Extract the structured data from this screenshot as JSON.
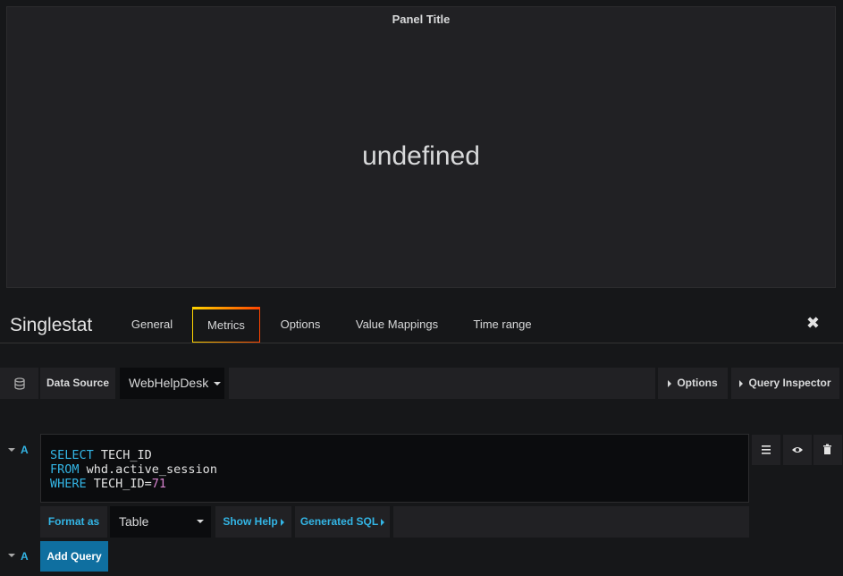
{
  "panel": {
    "title": "Panel Title",
    "value": "undefined"
  },
  "editor": {
    "title": "Singlestat",
    "tabs": [
      {
        "label": "General"
      },
      {
        "label": "Metrics",
        "active": true
      },
      {
        "label": "Options"
      },
      {
        "label": "Value Mappings"
      },
      {
        "label": "Time range"
      }
    ],
    "close_icon": "close-icon"
  },
  "datasource_row": {
    "label": "Data Source",
    "selected": "WebHelpDesk",
    "options_label": "Options",
    "query_inspector_label": "Query Inspector"
  },
  "query": {
    "ref_id": "A",
    "sql": {
      "line1_kw": "SELECT",
      "line1_rest": " TECH_ID",
      "line2_kw": "FROM",
      "line2_rest": " whd.active_session",
      "line3_kw": "WHERE",
      "line3_rest": " TECH_ID=",
      "line3_num": "71"
    },
    "format_as_label": "Format as",
    "format_value": "Table",
    "show_help_label": "Show Help",
    "generated_sql_label": "Generated SQL"
  },
  "add_query": {
    "ref_id": "A",
    "label": "Add Query"
  },
  "colors": {
    "accent": "#33b5e5",
    "add_button": "#0f6fa0",
    "background": "#161719"
  }
}
